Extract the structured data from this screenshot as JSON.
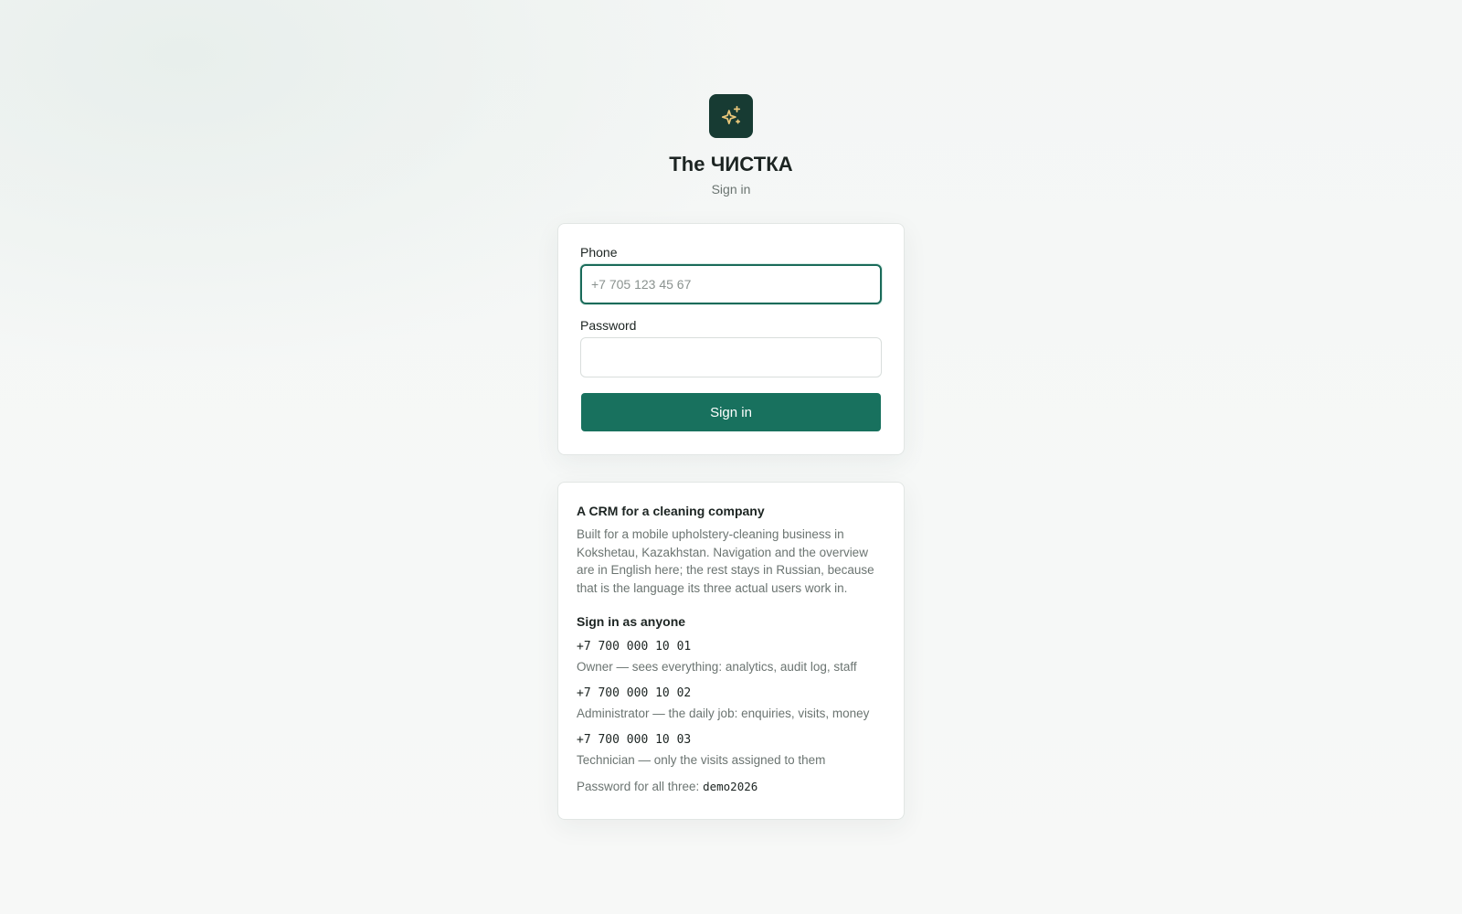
{
  "brand": {
    "logo_icon": "sparkles-icon",
    "title": "The ЧИСТКА",
    "subtitle": "Sign in"
  },
  "colors": {
    "accent": "#18715e",
    "logo_bg": "#173b33",
    "logo_icon": "#e9c77a"
  },
  "form": {
    "phone_label": "Phone",
    "phone_placeholder": "+7 705 123 45 67",
    "phone_value": "",
    "password_label": "Password",
    "password_value": "",
    "submit_label": "Sign in"
  },
  "info": {
    "title": "A CRM for a cleaning company",
    "text": "Built for a mobile upholstery-cleaning business in Kokshetau, Kazakhstan. Navigation and the overview are in English here; the rest stays in Russian, because that is the language its three actual users work in.",
    "demo_title": "Sign in as anyone",
    "accounts": [
      {
        "phone": "+7 700 000 10 01",
        "desc": "Owner — sees everything: analytics, audit log, staff"
      },
      {
        "phone": "+7 700 000 10 02",
        "desc": "Administrator — the daily job: enquiries, visits, money"
      },
      {
        "phone": "+7 700 000 10 03",
        "desc": "Technician — only the visits assigned to them"
      }
    ],
    "password_prefix": "Password for all three:",
    "password_code": "demo2026"
  }
}
